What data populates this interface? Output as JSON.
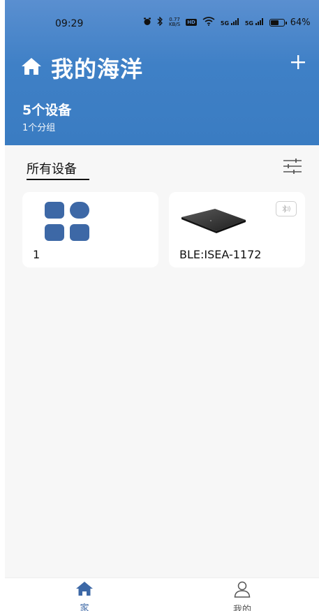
{
  "status_bar": {
    "time": "09:29",
    "net_speed_value": "0.77",
    "net_speed_unit": "KB/S",
    "hd_label": "HD",
    "signal1": "5G",
    "signal2": "5G",
    "battery_percent": "64%",
    "battery_level": 0.64
  },
  "header": {
    "title": "我的海洋",
    "device_count": "5个设备",
    "group_count": "1个分组",
    "home_icon": "home-icon",
    "add_icon": "plus-icon"
  },
  "tabs": {
    "all_devices": "所有设备"
  },
  "devices": [
    {
      "label": "1",
      "icon": "grid-group-icon"
    },
    {
      "label": "BLE:ISEA-1172",
      "icon": "device-pad-image",
      "badge_icon": "bluetooth-icon"
    }
  ],
  "bottom_nav": {
    "home_label": "家",
    "mine_label": "我的"
  },
  "colors": {
    "header_blue": "#3f80c6",
    "accent": "#3d68a6",
    "background": "#f7f7f7"
  }
}
